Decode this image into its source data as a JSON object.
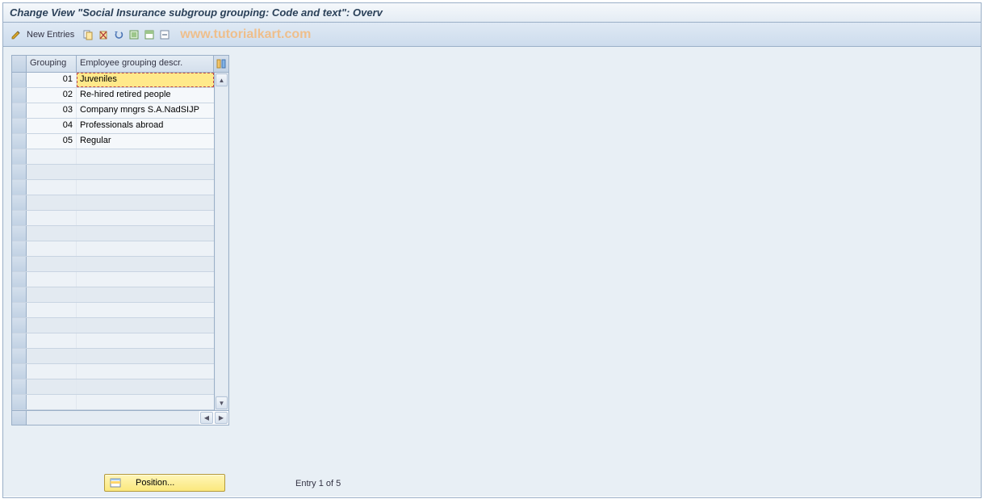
{
  "title": "Change View \"Social Insurance subgroup grouping: Code and text\": Overv",
  "toolbar": {
    "new_entries": "New Entries"
  },
  "watermark": "www.tutorialkart.com",
  "grid": {
    "col1_header": "Grouping",
    "col2_header": "Employee grouping descr.",
    "rows": [
      {
        "code": "01",
        "desc": "Juveniles"
      },
      {
        "code": "02",
        "desc": "Re-hired retired people"
      },
      {
        "code": "03",
        "desc": "Company mngrs S.A.NadSIJP"
      },
      {
        "code": "04",
        "desc": "Professionals abroad"
      },
      {
        "code": "05",
        "desc": "Regular"
      }
    ],
    "empty_rows": 17
  },
  "position_button": "Position...",
  "entry_status": "Entry 1 of 5"
}
